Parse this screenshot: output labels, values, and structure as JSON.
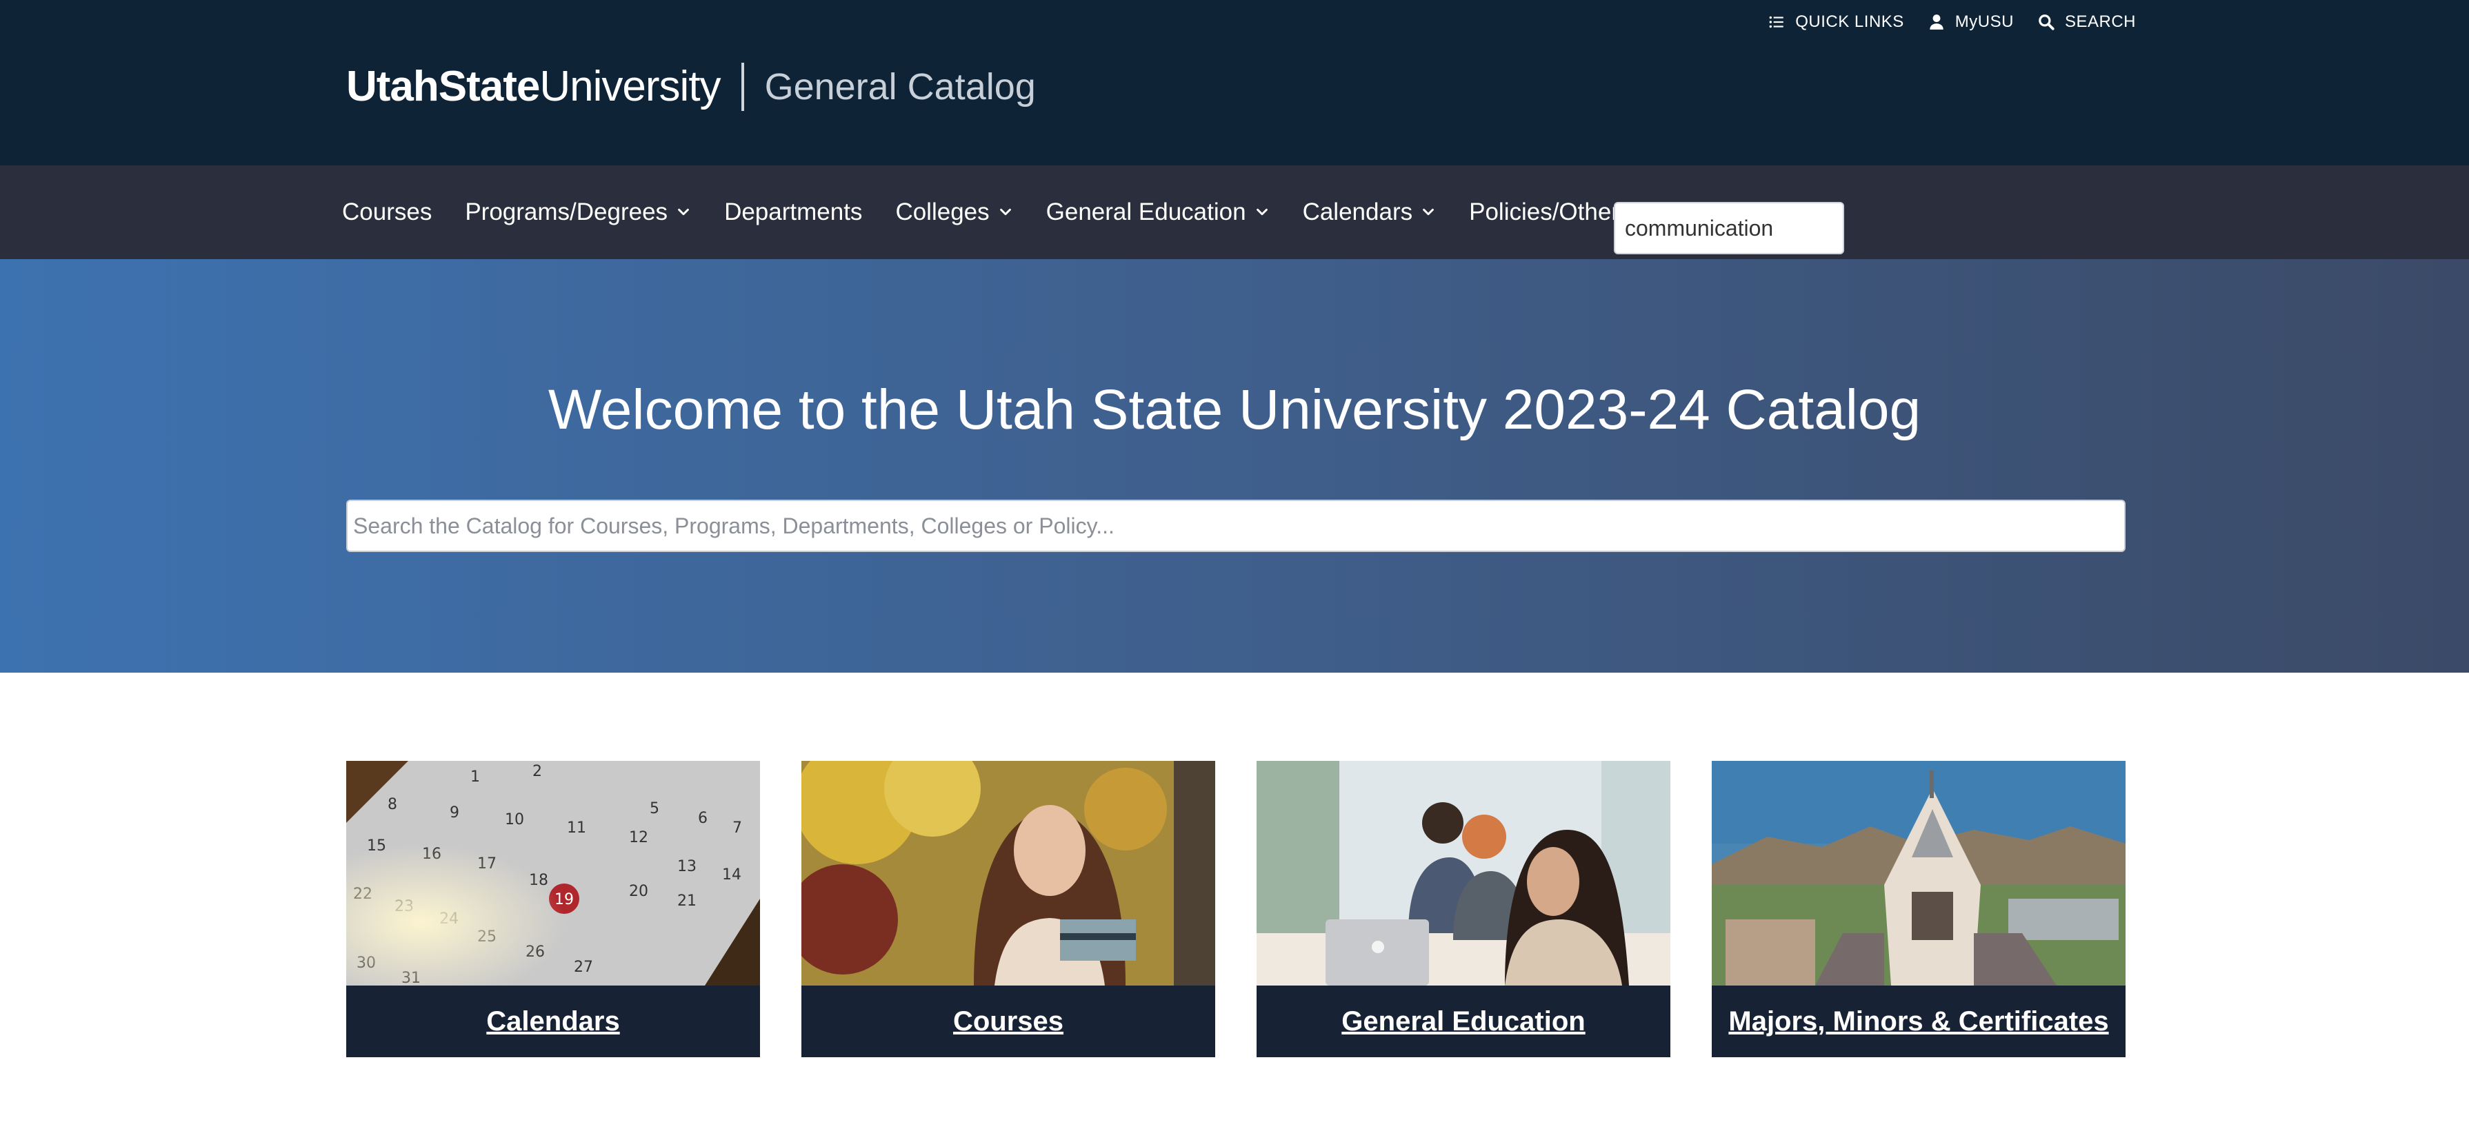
{
  "utility": {
    "quick_links": "QUICK LINKS",
    "myusu": "MyUSU",
    "search": "SEARCH"
  },
  "brand": {
    "logo_bold": "UtahState",
    "logo_light": "University",
    "catalog_title": "General Catalog"
  },
  "nav": {
    "items": [
      {
        "label": "Courses",
        "dropdown": false
      },
      {
        "label": "Programs/Degrees",
        "dropdown": true
      },
      {
        "label": "Departments",
        "dropdown": false
      },
      {
        "label": "Colleges",
        "dropdown": true
      },
      {
        "label": "General Education",
        "dropdown": true
      },
      {
        "label": "Calendars",
        "dropdown": true
      },
      {
        "label": "Policies/Other",
        "dropdown": false
      }
    ],
    "search_value": "communication"
  },
  "hero": {
    "title": "Welcome to the Utah State University 2023-24 Catalog",
    "search_placeholder": "Search the Catalog for Courses, Programs, Departments, Colleges or Policy..."
  },
  "cards": [
    {
      "label": "Calendars",
      "image": "calendar-photo"
    },
    {
      "label": "Courses",
      "image": "student-photo"
    },
    {
      "label": "General Education",
      "image": "study-room-photo"
    },
    {
      "label": "Majors, Minors & Certificates",
      "image": "campus-tower-photo"
    }
  ],
  "colors": {
    "header_bg": "#0f2337",
    "nav_bg": "#2b2f3d",
    "hero_start": "#3d72b0",
    "hero_end": "#3b4a67",
    "card_caption_bg": "#172235"
  }
}
